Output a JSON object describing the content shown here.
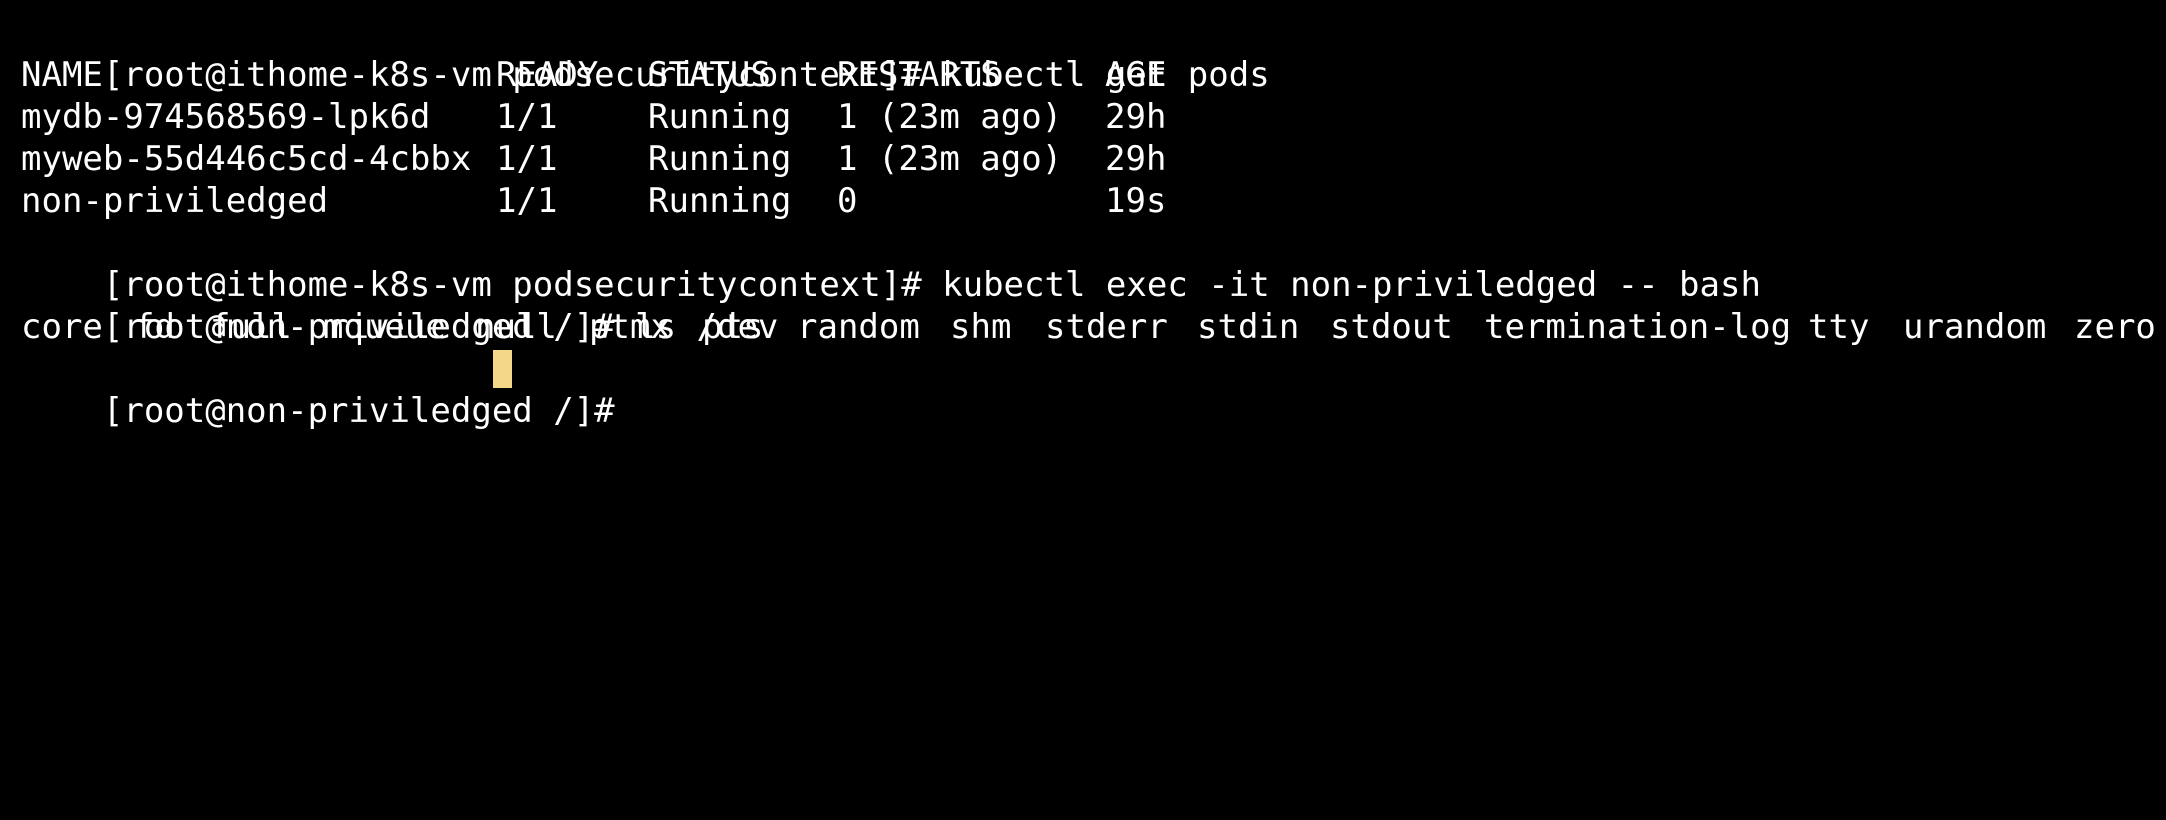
{
  "terminal": {
    "cursor_color": "#f5d78a",
    "text_color": "#ffffff",
    "background_color": "#000000",
    "line1": "[root@ithome-k8s-vm podsecuritycontext]# kubectl get pods",
    "headers": [
      "NAME",
      "READY",
      "STATUS",
      "RESTARTS",
      "AGE"
    ],
    "rows": [
      [
        "mydb-974568569-lpk6d",
        "1/1",
        "Running",
        "1 (23m ago)",
        "29h"
      ],
      [
        "myweb-55d446c5cd-4cbbx",
        "1/1",
        "Running",
        "1 (23m ago)",
        "29h"
      ],
      [
        "non-priviledged",
        "1/1",
        "Running",
        "0",
        "19s"
      ]
    ],
    "line6": "[root@ithome-k8s-vm podsecuritycontext]# kubectl exec -it non-priviledged -- bash",
    "line7": "[root@non-priviledged /]# ls /dev",
    "dev_entries": [
      "core",
      "fd",
      "full",
      "mqueue",
      "null",
      "ptmx",
      "pts",
      "random",
      "shm",
      "stderr",
      "stdin",
      "stdout",
      "termination-log",
      "tty",
      "urandom",
      "zero"
    ],
    "prompt": "[root@non-priviledged /]# "
  }
}
